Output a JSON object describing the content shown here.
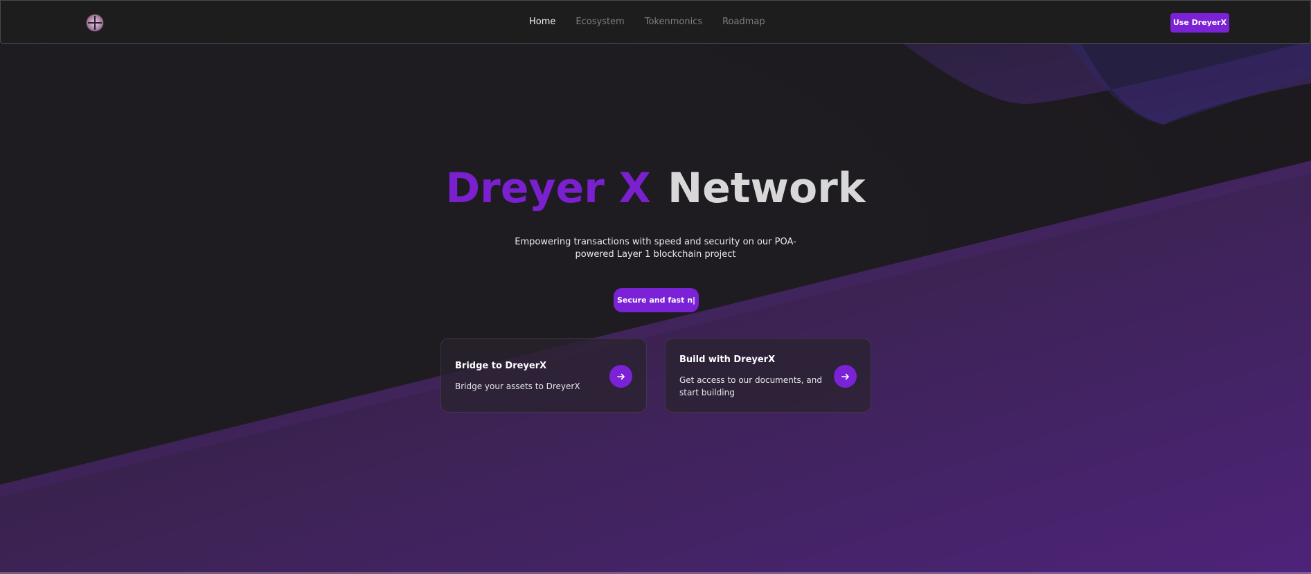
{
  "nav": {
    "logo_label": "",
    "links": [
      {
        "label": "Home",
        "active": true
      },
      {
        "label": "Ecosystem",
        "active": false
      },
      {
        "label": "Tokenmonics",
        "active": false
      },
      {
        "label": "Roadmap",
        "active": false
      }
    ],
    "cta": "Use DreyerX"
  },
  "hero": {
    "title_accent": "Dreyer X",
    "title_main": "Network",
    "subtitle": "Empowering transactions with speed and security on our POA-powered Layer 1 blockchain project",
    "pill_text": "Secure and fast n|"
  },
  "cards": [
    {
      "title": "Bridge to DreyerX",
      "description": "Bridge your assets to DreyerX",
      "icon": "arrow-right-icon"
    },
    {
      "title": "Build with DreyerX",
      "description": "Get access to our documents, and start building",
      "icon": "arrow-right-icon"
    }
  ],
  "colors": {
    "brand": "#7b22d6",
    "navbar_bg": "#1d1d1d",
    "page_bg": "#1e1c20"
  }
}
